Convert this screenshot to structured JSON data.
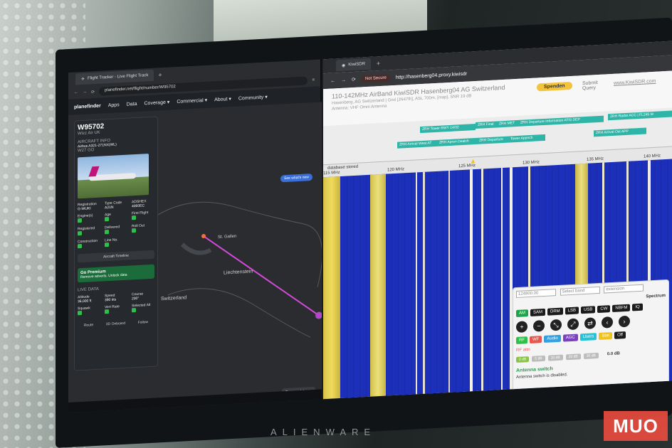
{
  "photo": {
    "brand": "ALIENWARE",
    "watermark": "MUO"
  },
  "left_browser": {
    "tab_title": "Flight Tracker - Live Flight Track",
    "url": "planefinder.net/flight/number/W95702",
    "nav": {
      "logo": "planefinder",
      "items": [
        "Apps",
        "Data",
        "Coverage ▾",
        "Commercial ▾",
        "About ▾",
        "Community ▾"
      ]
    },
    "see_whats_new": "See what's new",
    "panel": {
      "flight": "W95702",
      "airline": "Wizz Air UK",
      "aircraft_header": "AIRCRAFT INFO",
      "aircraft": "Airbus A321-271NX(WL)",
      "reg_short": "W27 GO",
      "fields": [
        {
          "label": "Registration",
          "value": "G-WUKI"
        },
        {
          "label": "Type Code",
          "value": "A21N"
        },
        {
          "label": "ADSHEX",
          "value": "4060EC"
        },
        {
          "label": "Engine(s)",
          "value": ""
        },
        {
          "label": "Age",
          "value": ""
        },
        {
          "label": "First Flight",
          "value": ""
        },
        {
          "label": "Registered",
          "value": ""
        },
        {
          "label": "Delivered",
          "value": ""
        },
        {
          "label": "Roll Out",
          "value": ""
        },
        {
          "label": "Construction",
          "value": ""
        },
        {
          "label": "Line No.",
          "value": ""
        }
      ],
      "aircraft_timeline": "Aircraft Timeline",
      "premium_title": "Go Premium",
      "premium_sub": "Remove adverts. Unlock data",
      "live_header": "LIVE DATA",
      "live": [
        {
          "label": "Altitude",
          "value": "36,000 ft"
        },
        {
          "label": "Speed",
          "value": "390 kts"
        },
        {
          "label": "Course",
          "value": "200°"
        },
        {
          "label": "Squawk",
          "value": ""
        },
        {
          "label": "Vert Rate",
          "value": ""
        },
        {
          "label": "Selected Alt",
          "value": ""
        }
      ],
      "bottom_tabs": [
        "Route",
        "3D Onboard",
        "Follow"
      ]
    },
    "map_labels": {
      "city1": "St. Gallen",
      "city2": "Liechtenstein",
      "city3": "Switzerland"
    },
    "remove_adverts": "Remove Adverts"
  },
  "right_browser": {
    "tab_title": "KiwiSDR",
    "not_secure": "Not Secure",
    "url": "http://hasenberg04.proxy.kiwisdr",
    "header_title": "110-142MHz AirBand KiwiSDR Hasenberg04 AG Switzerland",
    "header_sub1": "Hasenberg, AG Switzerland | Grid [JN47fh], ASL 700m, [map], SNR 19 dB",
    "header_sub2": "Antenna: VHF Omni Antenna",
    "spenden": "Spenden",
    "submit": "Submit",
    "query": "Query",
    "kiwisdr_link": "www.KiwiSDR.com",
    "bands": [
      "ZRH Tower RWY 14/32",
      "ZRH Final",
      "ZRH MET",
      "ZRH Departure Information ATIS DEP",
      "ZRH Radar ACC | FL245 M",
      "ZRH Arrival West AT",
      "ZRH Apron Dealch",
      "ZRH Departure",
      "Tower Appnch",
      "ZRH Arrival Ost APP"
    ],
    "scale_label": "database stored",
    "ticks": [
      "115 MHz",
      "120 MHz",
      "125 MHz",
      "130 MHz",
      "135 MHz",
      "140 MHz"
    ],
    "control": {
      "freq": "124800.00",
      "select_band": "Select band",
      "ext": "extension",
      "spectrum": "Spectrum",
      "modes": [
        "AM",
        "SAM",
        "DRM",
        "LSB",
        "USB",
        "CW",
        "NBFM",
        "IQ"
      ],
      "chips": [
        {
          "label": "RF",
          "color": "#2fbf4a"
        },
        {
          "label": "WF",
          "color": "#e8564c"
        },
        {
          "label": "Audio",
          "color": "#33a0e0"
        },
        {
          "label": "AGC",
          "color": "#7b3fbf"
        },
        {
          "label": "Users",
          "color": "#27c2d8"
        },
        {
          "label": "Stat",
          "color": "#f0c21f"
        },
        {
          "label": "Off",
          "color": "#1b1b1b"
        }
      ],
      "rf_attn": "RF attn",
      "db_buttons": [
        "0 dB",
        "5 dB",
        "10 dB",
        "20 dB",
        "30 dB"
      ],
      "db_value": "0.0 dB",
      "antenna_switch": "Antenna switch",
      "antenna_msg": "Antenna switch is disabled."
    }
  }
}
